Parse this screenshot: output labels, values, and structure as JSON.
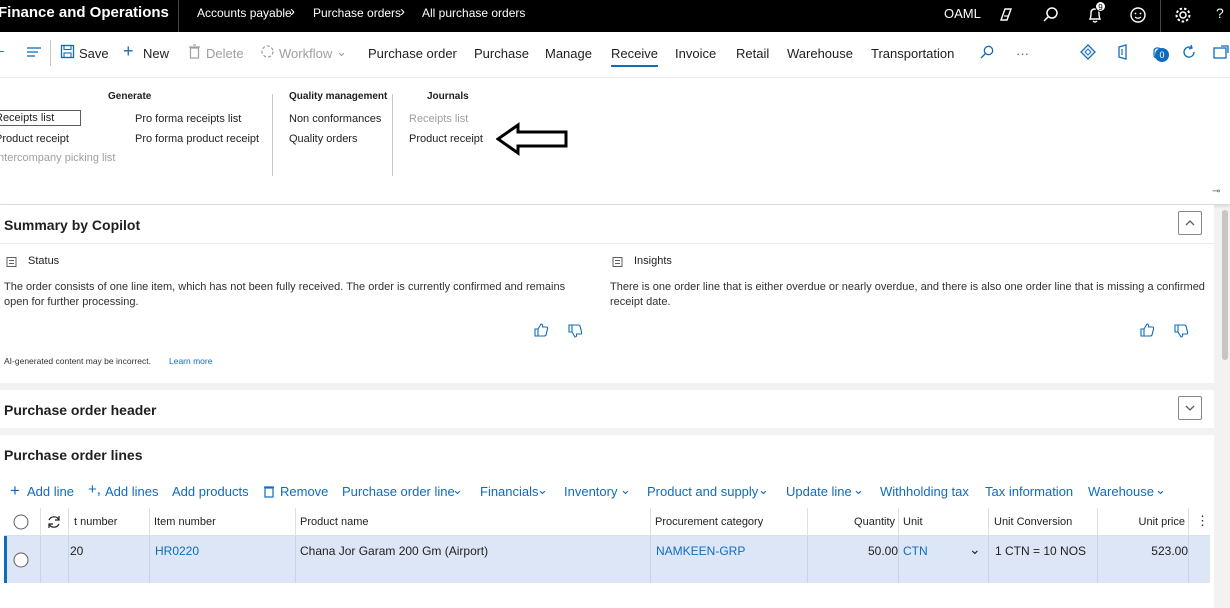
{
  "topbar": {
    "app_title": "Finance and Operations",
    "breadcrumbs": [
      "Accounts payable",
      "Purchase orders",
      "All purchase orders"
    ],
    "company": "OAML",
    "notification_count": "9"
  },
  "actions": {
    "save": "Save",
    "new": "New",
    "delete": "Delete",
    "workflow": "Workflow",
    "tabs": [
      "Purchase order",
      "Purchase",
      "Manage",
      "Receive",
      "Invoice",
      "Retail",
      "Warehouse",
      "Transportation"
    ],
    "active_tab": "Receive",
    "more": "···",
    "badge_count": "0"
  },
  "ribbon": {
    "generate": {
      "title": "Generate",
      "col1": [
        "Receipts list",
        "Product receipt",
        "Intercompany picking list"
      ],
      "col2": [
        "Pro forma receipts list",
        "Pro forma product receipt"
      ]
    },
    "quality": {
      "title": "Quality management",
      "items": [
        "Non conformances",
        "Quality orders"
      ]
    },
    "journals": {
      "title": "Journals",
      "items": [
        "Receipts list",
        "Product receipt"
      ]
    }
  },
  "copilot": {
    "title": "Summary by Copilot",
    "status_title": "Status",
    "status_text": "The order consists of one line item, which has not been fully received. The order is currently confirmed and remains open for further processing.",
    "insights_title": "Insights",
    "insights_text": "There is one order line that is either overdue or nearly overdue, and there is also one order line that is missing a confirmed receipt date.",
    "disclaimer": "AI-generated content may be incorrect.",
    "learn_more": "Learn more"
  },
  "header_section": {
    "title": "Purchase order header"
  },
  "lines": {
    "title": "Purchase order lines",
    "toolbar": [
      "Add line",
      "Add lines",
      "Add products",
      "Remove",
      "Purchase order line",
      "Financials",
      "Inventory",
      "Product and supply",
      "Update line",
      "Withholding tax",
      "Tax information",
      "Warehouse"
    ],
    "columns": [
      "t number",
      "Item number",
      "Product name",
      "Procurement category",
      "Quantity",
      "Unit",
      "Unit Conversion",
      "Unit price"
    ],
    "row": {
      "line_number": "20",
      "item_number": "HR0220",
      "product_name": "Chana Jor Garam 200 Gm (Airport)",
      "procurement_category": "NAMKEEN-GRP",
      "quantity": "50.00",
      "unit": "CTN",
      "unit_conversion": "1 CTN = 10 NOS",
      "unit_price": "523.00"
    }
  }
}
